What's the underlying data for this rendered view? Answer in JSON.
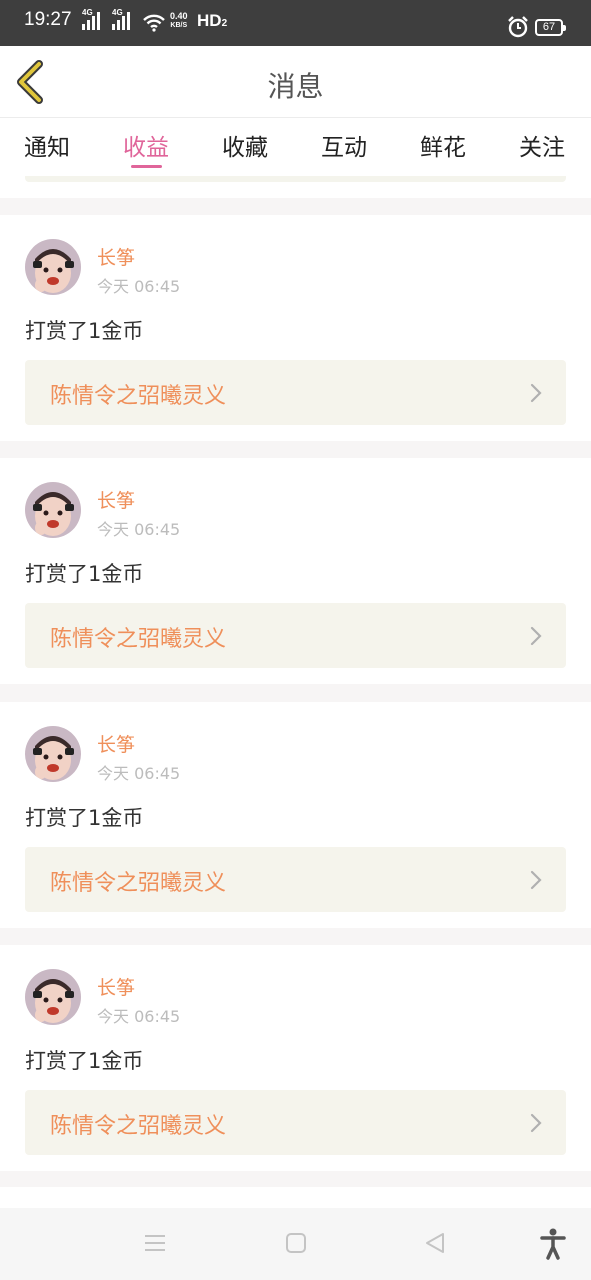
{
  "status_bar": {
    "time": "19:27",
    "signal_1": "4G",
    "signal_2": "4G",
    "speed_value": "0.40",
    "speed_unit": "KB/S",
    "hd": "HD",
    "hd_sub": "2",
    "battery": "67"
  },
  "header": {
    "title": "消息",
    "back_icon": "chevron-left-icon"
  },
  "tabs": [
    {
      "label": "通知",
      "active": false
    },
    {
      "label": "收益",
      "active": true
    },
    {
      "label": "收藏",
      "active": false
    },
    {
      "label": "互动",
      "active": false
    },
    {
      "label": "鲜花",
      "active": false
    },
    {
      "label": "关注",
      "active": false
    }
  ],
  "cards": [
    {
      "username": "长筝",
      "time": "今天 06:45",
      "message": "打赏了1金币",
      "book": "陈情令之弨曦灵义"
    },
    {
      "username": "长筝",
      "time": "今天 06:45",
      "message": "打赏了1金币",
      "book": "陈情令之弨曦灵义"
    },
    {
      "username": "长筝",
      "time": "今天 06:45",
      "message": "打赏了1金币",
      "book": "陈情令之弨曦灵义"
    },
    {
      "username": "长筝",
      "time": "今天 06:45",
      "message": "打赏了1金币",
      "book": "陈情令之弨曦灵义"
    }
  ],
  "colors": {
    "accent": "#e0659a",
    "username": "#ef8f5a",
    "back_icon": "#e0c63c",
    "book_bg": "#f5f4ec"
  },
  "nav_bar": {
    "icons": [
      "menu-icon",
      "home-square-icon",
      "back-triangle-icon",
      "accessibility-icon"
    ]
  }
}
